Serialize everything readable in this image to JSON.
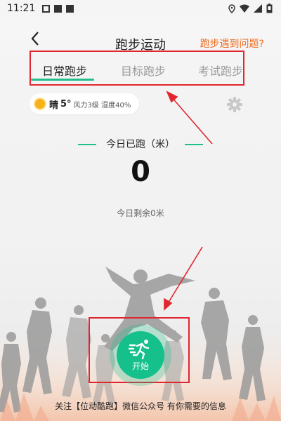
{
  "status_bar": {
    "time": "11:21"
  },
  "header": {
    "title": "跑步运动",
    "help_link": "跑步遇到问题?"
  },
  "tabs": [
    {
      "label": "日常跑步",
      "active": true
    },
    {
      "label": "目标跑步",
      "active": false
    },
    {
      "label": "考试跑步",
      "active": false
    }
  ],
  "weather": {
    "condition": "晴",
    "temperature": "5°",
    "details": "风力3级 湿度40%"
  },
  "today": {
    "label": "今日已跑（米）",
    "distance": "0",
    "remaining": "今日剩余0米"
  },
  "start_button": {
    "label": "开始"
  },
  "footer": {
    "tip": "关注【位动酷跑】微信公众号 有你需要的信息"
  },
  "colors": {
    "accent": "#1fbe8a",
    "link": "#f26b1d",
    "annotation": "#e0262e"
  }
}
